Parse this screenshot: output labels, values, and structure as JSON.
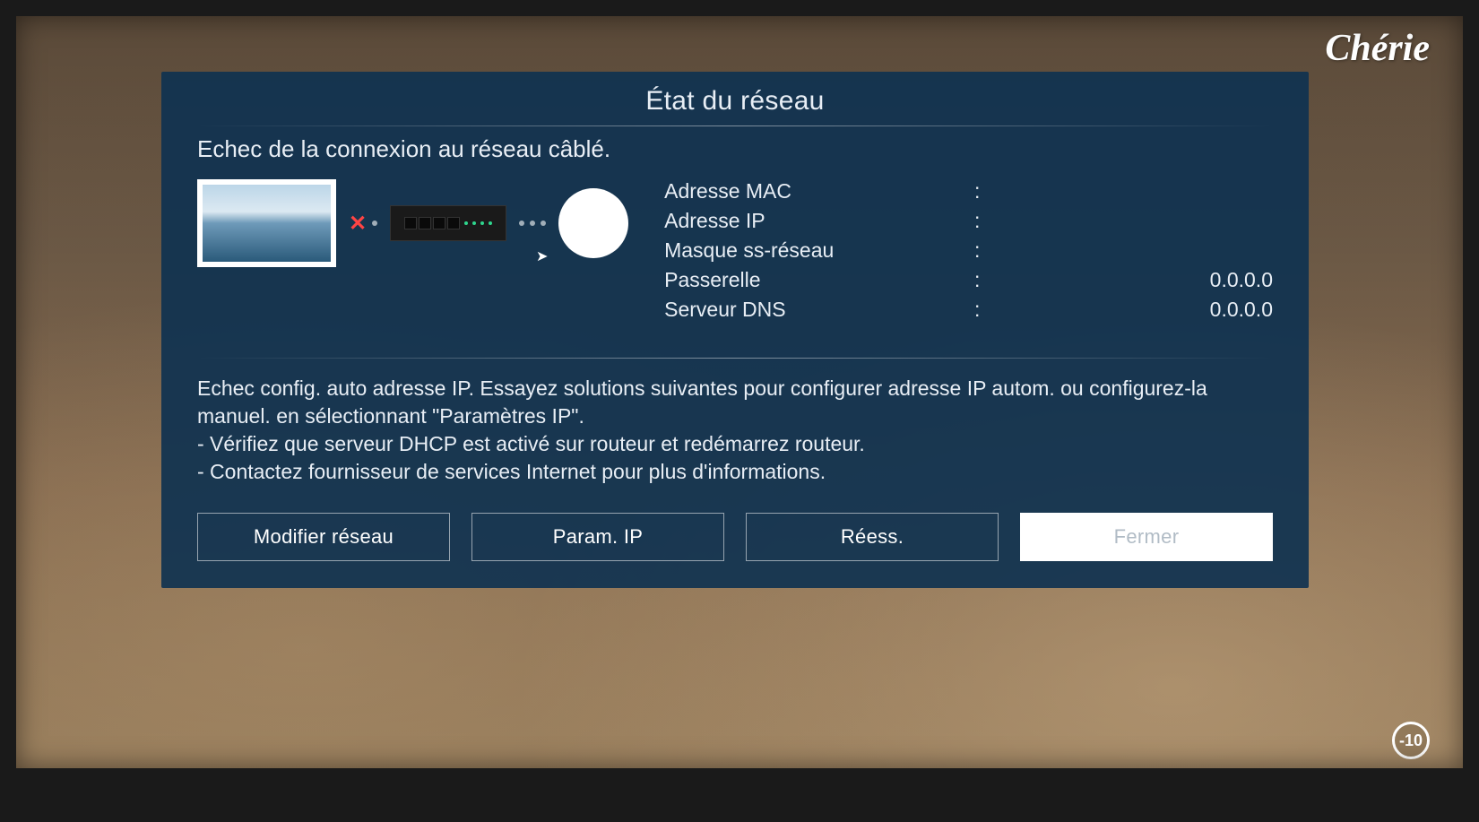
{
  "title": "État du réseau",
  "status_message": "Echec de la connexion au réseau câblé.",
  "info": {
    "mac_label": "Adresse MAC",
    "mac_value": "",
    "ip_label": "Adresse IP",
    "ip_value": "",
    "subnet_label": "Masque ss-réseau",
    "subnet_value": "",
    "gateway_label": "Passerelle",
    "gateway_value": "0.0.0.0",
    "dns_label": "Serveur DNS",
    "dns_value": "0.0.0.0"
  },
  "explain": {
    "line1": "Echec config. auto adresse IP. Essayez solutions suivantes pour configurer adresse IP autom. ou configurez-la manuel. en sélectionnant \"Paramètres IP\".",
    "line2": "- Vérifiez que serveur DHCP est activé sur routeur et redémarrez routeur.",
    "line3": "- Contactez fournisseur de services Internet pour plus d'informations."
  },
  "buttons": {
    "modify": "Modifier réseau",
    "param_ip": "Param. IP",
    "retry": "Réess.",
    "close": "Fermer"
  },
  "channel_logo": "Chérie",
  "age_rating": "-10"
}
